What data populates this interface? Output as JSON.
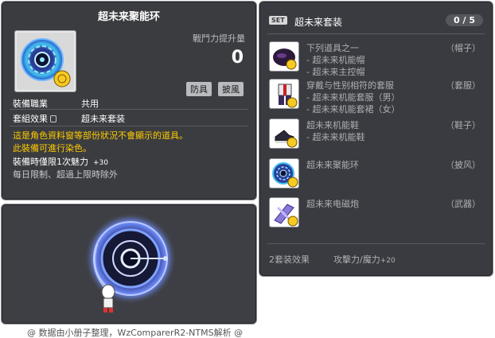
{
  "item_id": "01103672",
  "item": {
    "name": "超未来聚能环",
    "atk_label": "戰鬥力提升量",
    "atk_value": "0",
    "tags": [
      "防具",
      "披風"
    ],
    "job_label": "裝備職業",
    "job_value": "共用",
    "set_label": "套組效果",
    "set_value": "超未来套装",
    "desc_line1": "這是角色資料窗等部份狀況不會顯示的道具。",
    "desc_line2": "此裝備可進行染色。",
    "desc_line3": "裝備時僅限1次魅力",
    "desc_line3_bonus": "+30",
    "desc_line4": "每日限制、超過上限時除外"
  },
  "set": {
    "badge": "SET",
    "name": "超未来套装",
    "count": "0 / 5",
    "items": [
      {
        "icon": "hat-icon",
        "lines": [
          "下列道具之一",
          "- 超未来机能帽",
          "- 超未来主控帽"
        ],
        "slot": "（帽子）"
      },
      {
        "icon": "overall-suit-icon",
        "lines": [
          "穿戴与性别相符的套服",
          "- 超未来机能套服（男）",
          "- 超未来机能套裙（女）"
        ],
        "slot": "（套服）"
      },
      {
        "icon": "shoes-icon",
        "lines": [
          "超未来机能鞋",
          "- 超未来机能鞋"
        ],
        "slot": "（鞋子）"
      },
      {
        "icon": "cape-ring-icon",
        "lines": [
          "超未来聚能环"
        ],
        "slot": "（披风）"
      },
      {
        "icon": "cannon-weapon-icon",
        "lines": [
          "超未来电磁炮"
        ],
        "slot": "（武器）"
      }
    ],
    "effect_label": "2套装效果",
    "effect_text": "攻擊力/魔力",
    "effect_value": "+20"
  },
  "footer": "@ 数据由小册子整理，WzComparerR2-NTMS解析 @"
}
